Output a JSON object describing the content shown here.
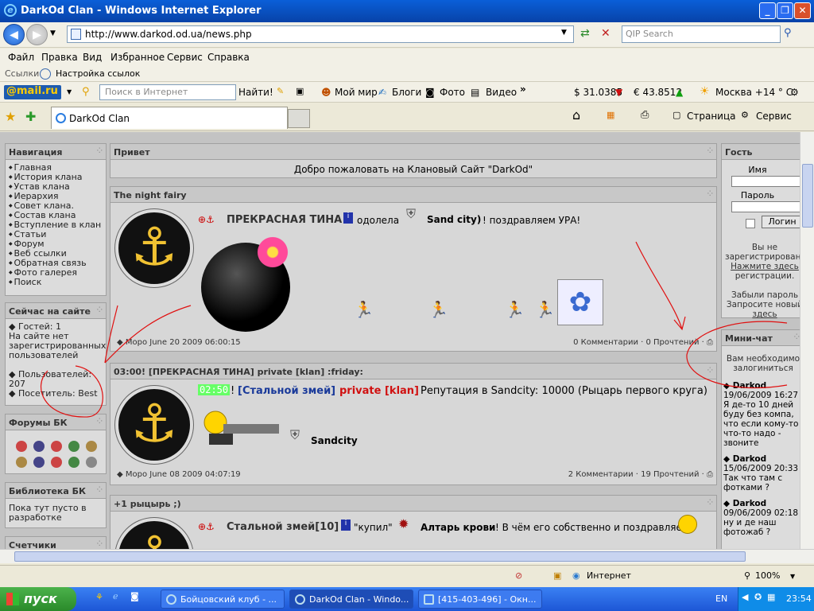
{
  "window": {
    "title": "DarkOd Clan - Windows Internet Explorer",
    "min": "_",
    "max": "❐",
    "close": "✕"
  },
  "address": {
    "url": "http://www.darkod.od.ua/news.php",
    "search_placeholder": "QIP Search"
  },
  "menu": [
    "Файл",
    "Правка",
    "Вид",
    "Избранное",
    "Сервис",
    "Справка"
  ],
  "links": {
    "label": "Ссылки",
    "item": "Настройка ссылок"
  },
  "mailbar": {
    "logo": "@mail.ru",
    "search_placeholder": "Поиск в Интернет",
    "find": "Найти!",
    "items": [
      "Мой мир",
      "Блоги",
      "Фото",
      "Видео"
    ],
    "usd": "$ 31.0385",
    "eur": "€ 43.8512",
    "weather": "Москва +14 ° С"
  },
  "tabs": {
    "active": "DarkOd Clan",
    "page": "Страница",
    "tools": "Сервис"
  },
  "nav": {
    "title": "Навигация",
    "items": [
      "Главная",
      "История клана",
      "Устав клана",
      "Иерархия",
      "Совет клана.",
      "Состав клана",
      "Вступление в клан",
      "Статьи",
      "Форум",
      "Веб ссылки",
      "Обратная связь",
      "Фото галерея",
      "Поиск"
    ]
  },
  "online": {
    "title": "Сейчас на сайте",
    "guests": "Гостей: 1",
    "no_users": "На сайте нет зарегистрированных пользователей",
    "users": "Пользователей: 207",
    "visitor": "Посетитель: Best"
  },
  "forums": {
    "title": "Форумы БК"
  },
  "library": {
    "title": "Библиотека БК",
    "text": "Пока тут пусто в разработке"
  },
  "counters": {
    "title": "Счетчики"
  },
  "hello": {
    "title": "Привет",
    "text": "Добро пожаловать на Клановый Сайт \"DarkOd\""
  },
  "news": [
    {
      "title": "The night fairy",
      "line_a": "ПРЕКРАСНАЯ ТИНА",
      "line_b": "одолела",
      "line_c": "Sand city)",
      "line_d": "! поздравляем УРА!",
      "author": "Моро June 20 2009 06:00:15",
      "stats": "0 Комментарии · 0 Прочтений"
    },
    {
      "title": "03:00! [ПРЕКРАСНАЯ ТИНА] private [klan] :friday:",
      "time": "02:50",
      "p1": "!",
      "p2": "[Стальной змей]",
      "p3": "private [klan]",
      "p4": "Репутация в Sandcity: 10000 (Рыцарь первого круга)",
      "city": "Sandcity",
      "author": "Моро June 08 2009 04:07:19",
      "stats": "2 Комментарии · 19 Прочтений"
    },
    {
      "title": "+1 рыцырь ;)",
      "line_a": "Стальной змей[10]",
      "line_b": "\"купил\"",
      "line_c": "Алтарь крови",
      "line_d": "! В чём его собственно и поздравляем"
    }
  ],
  "guest": {
    "title": "Гость",
    "name": "Имя",
    "pass": "Пароль",
    "login": "Логин",
    "not_reg": "Вы не зарегистрированы",
    "click": "Нажмите здесь",
    "reg": "регистрации.",
    "forgot": "Забыли пароль",
    "request": "Запросите новый",
    "here": "здесь"
  },
  "chat": {
    "title": "Мини-чат",
    "need": "Вам необходимо залогиниться",
    "msgs": [
      {
        "u": "Darkod",
        "d": "19/06/2009 16:27",
        "t": "Я де-то 10 дней буду без компа, что если кому-то что-то надо - звоните"
      },
      {
        "u": "Darkod",
        "d": "15/06/2009 20:33",
        "t": "Так что там с фотками ?"
      },
      {
        "u": "Darkod",
        "d": "09/06/2009 02:18",
        "t": "ну и де наш фотожаб ?"
      }
    ]
  },
  "status": {
    "zone": "Интернет",
    "zoom": "100%"
  },
  "taskbar": {
    "start": "пуск",
    "items": [
      "Бойцовский клуб - ...",
      "DarkOd Clan - Windo...",
      "[415-403-496] - Окн..."
    ],
    "lang": "EN",
    "clock": "23:54"
  }
}
